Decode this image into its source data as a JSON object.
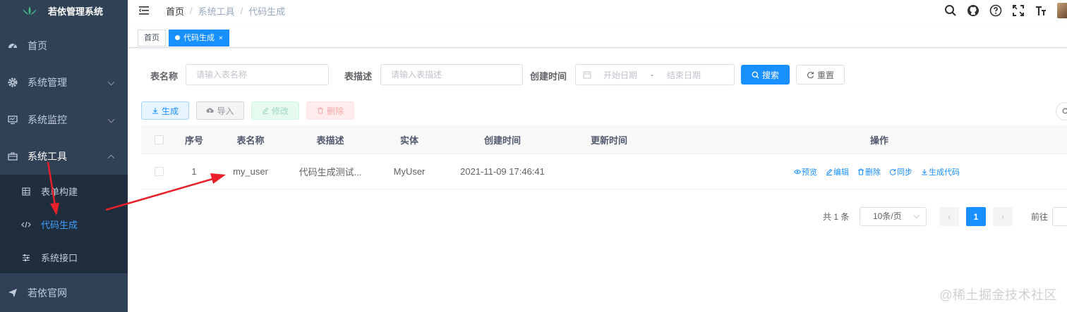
{
  "app": {
    "title": "若依管理系统"
  },
  "sidebar": {
    "items": [
      {
        "label": "首页",
        "icon": "dashboard-icon"
      },
      {
        "label": "系统管理",
        "icon": "gear-icon"
      },
      {
        "label": "系统监控",
        "icon": "monitor-icon"
      },
      {
        "label": "系统工具",
        "icon": "toolbox-icon"
      },
      {
        "label": "若依官网",
        "icon": "send-icon"
      }
    ],
    "submenu": [
      {
        "label": "表单构建",
        "icon": "table-icon"
      },
      {
        "label": "代码生成",
        "icon": "code-icon"
      },
      {
        "label": "系统接口",
        "icon": "sliders-icon"
      }
    ]
  },
  "header": {
    "breadcrumb": [
      "首页",
      "系统工具",
      "代码生成"
    ]
  },
  "tags": [
    {
      "label": "首页"
    },
    {
      "label": "代码生成",
      "close": "×"
    }
  ],
  "search": {
    "table_name_label": "表名称",
    "table_name_placeholder": "请输入表名称",
    "table_desc_label": "表描述",
    "table_desc_placeholder": "请输入表描述",
    "create_time_label": "创建时间",
    "start_placeholder": "开始日期",
    "range_sep": "-",
    "end_placeholder": "结束日期",
    "search_btn": "搜索",
    "reset_btn": "重置"
  },
  "toolbar": {
    "generate": "生成",
    "import": "导入",
    "edit": "修改",
    "delete": "删除"
  },
  "table": {
    "headers": [
      "序号",
      "表名称",
      "表描述",
      "实体",
      "创建时间",
      "更新时间",
      "操作"
    ],
    "rows": [
      {
        "index": "1",
        "table_name": "my_user",
        "table_desc": "代码生成测试...",
        "entity": "MyUser",
        "create_time": "2021-11-09 17:46:41",
        "update_time": "",
        "ops": [
          "预览",
          "编辑",
          "删除",
          "同步",
          "生成代码"
        ]
      }
    ]
  },
  "pagination": {
    "total": "共 1 条",
    "page_size": "10条/页",
    "prev": "‹",
    "current": "1",
    "next": "›",
    "jump": "前往"
  },
  "watermark": "@稀土掘金技术社区",
  "colors": {
    "sidebar_bg": "#304156",
    "submenu_bg": "#1f2d3d",
    "primary": "#1890ff",
    "annotation": "#e8202a"
  }
}
